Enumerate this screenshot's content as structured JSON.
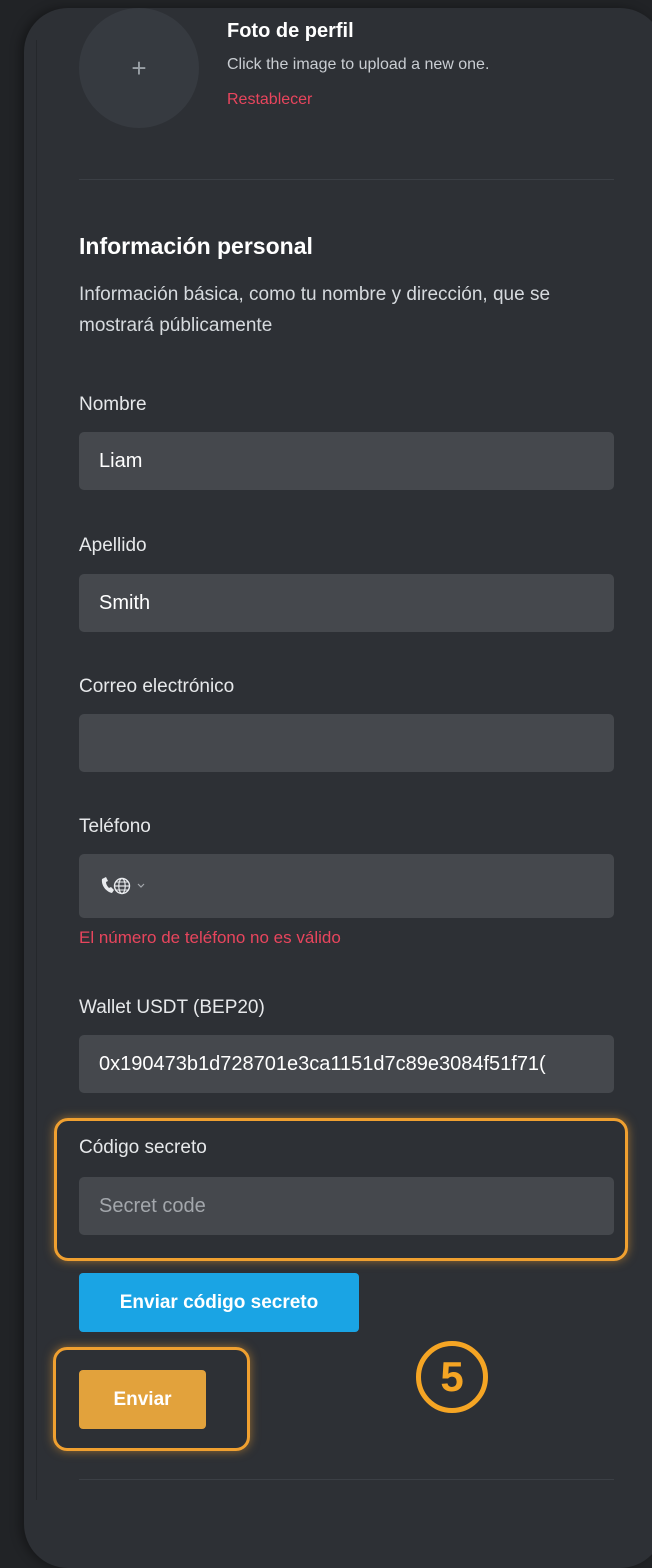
{
  "profile_photo": {
    "avatar_symbol": "+",
    "title": "Foto de perfil",
    "hint": "Click the image to upload a new one.",
    "reset_label": "Restablecer"
  },
  "personal_info": {
    "title": "Información personal",
    "description": "Información básica, como tu nombre y dirección, que se mostrará públicamente"
  },
  "form": {
    "first_name": {
      "label": "Nombre",
      "value": "Liam"
    },
    "last_name": {
      "label": "Apellido",
      "value": "Smith"
    },
    "email": {
      "label": "Correo electrónico",
      "value": ""
    },
    "phone": {
      "label": "Teléfono",
      "value": "",
      "prefix_icon": "phone-globe-icon",
      "error": "El número de teléfono no es válido"
    },
    "wallet": {
      "label": "Wallet USDT (BEP20)",
      "value": "0x190473b1d728701e3ca1151d7c89e3084f51f71("
    },
    "secret_code": {
      "label": "Código secreto",
      "placeholder": "Secret code",
      "value": ""
    }
  },
  "buttons": {
    "send_secret_label": "Enviar código secreto",
    "submit_label": "Enviar"
  },
  "annotation": {
    "step_number": "5"
  },
  "colors": {
    "background": "#212326",
    "card": "#2d3035",
    "input": "#45484d",
    "error": "#e8455d",
    "primary_button": "#1aa4e4",
    "submit_button": "#e2a23c",
    "highlight": "#f0a030"
  }
}
